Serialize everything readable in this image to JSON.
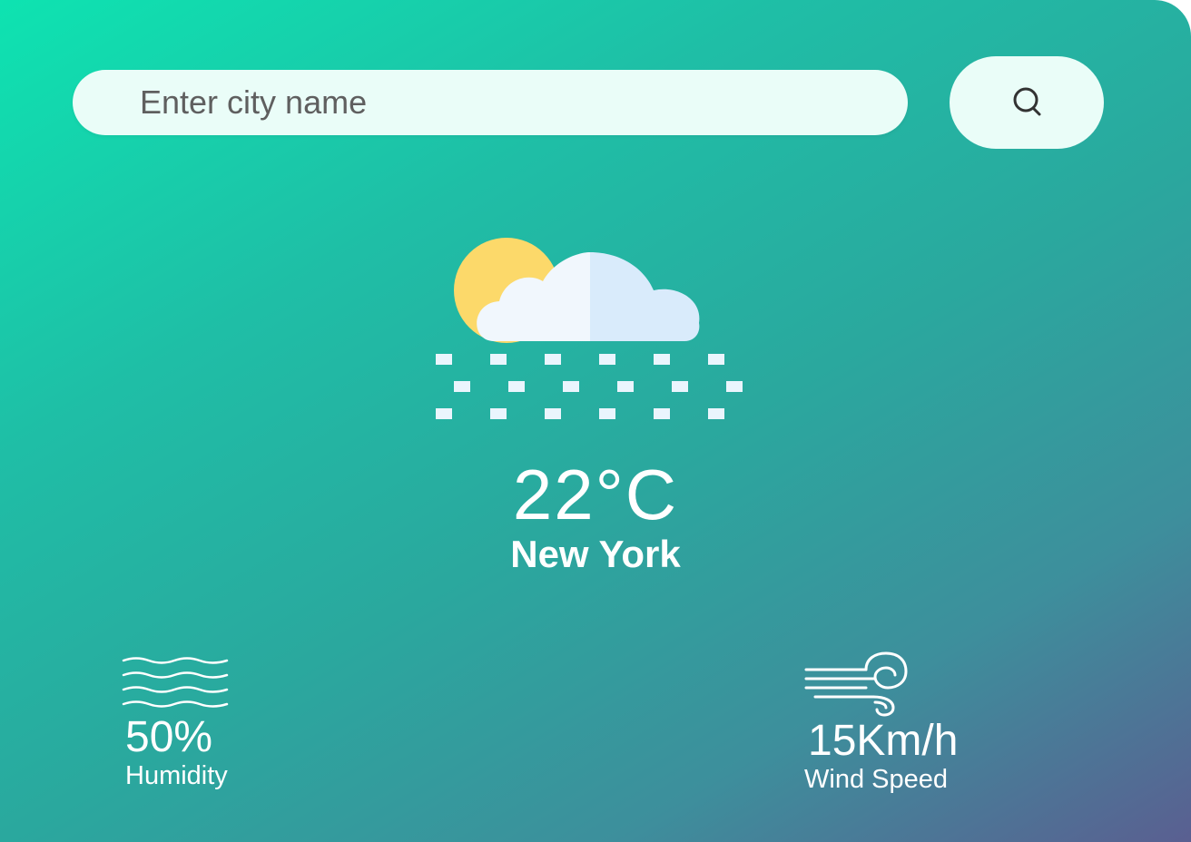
{
  "search": {
    "placeholder": "Enter city name",
    "value": "",
    "button_icon": "search-icon"
  },
  "weather": {
    "icon": "cloud-rain-sun-icon",
    "temperature": "22°C",
    "city": "New York"
  },
  "details": {
    "humidity": {
      "icon": "humidity-waves-icon",
      "value": "50%",
      "label": "Humidity"
    },
    "wind": {
      "icon": "wind-icon",
      "value": "15Km/h",
      "label": "Wind Speed"
    }
  },
  "colors": {
    "gradient_start": "#0ee3b1",
    "gradient_end": "#5a5f91",
    "search_bg": "#eafdf8",
    "sun": "#fcd96a",
    "cloud_light": "#f1f7fd",
    "cloud_shadow": "#d9ebfb"
  }
}
